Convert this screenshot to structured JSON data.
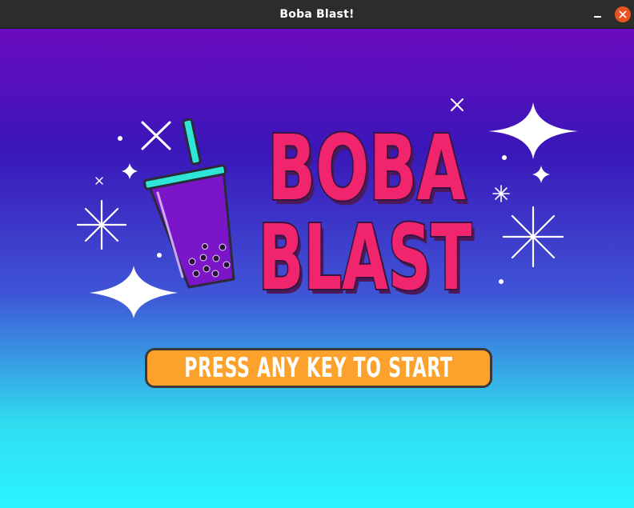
{
  "window": {
    "title": "Boba Blast!"
  },
  "logo": {
    "line1": "BOBA",
    "line2": "BLAST"
  },
  "start_button": {
    "label": "PRESS ANY KEY TO START"
  },
  "icons": {
    "drink": "boba-drink-icon",
    "sparkle": "sparkle-icon",
    "close": "close-icon",
    "minimize": "minimize-icon"
  },
  "colors": {
    "titlebar": "#2c2c2c",
    "close_button": "#e95420",
    "bg_top": "#6b0cbf",
    "bg_bottom": "#2af4ff",
    "logo_pink": "#f0256d",
    "logo_shadow": "#4a1a5a",
    "button_orange": "#fca12b",
    "straw_cyan": "#2ee6d6",
    "cup_purple": "#7a16c8"
  }
}
